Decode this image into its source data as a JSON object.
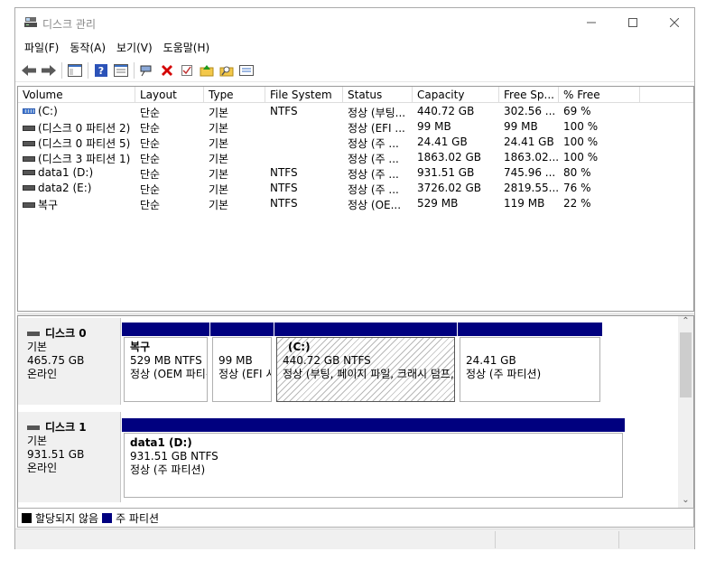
{
  "window": {
    "title": "디스크 관리"
  },
  "menu": [
    "파일(F)",
    "동작(A)",
    "보기(V)",
    "도움말(H)"
  ],
  "toolbar": [
    {
      "icon": "back-arrow-icon"
    },
    {
      "icon": "forward-arrow-icon"
    },
    {
      "icon": "console-tree-icon"
    },
    {
      "icon": "help-icon"
    },
    {
      "icon": "properties-icon"
    },
    {
      "icon": "connect-icon"
    },
    {
      "icon": "delete-icon"
    },
    {
      "icon": "check-icon"
    },
    {
      "icon": "folder-up-icon"
    },
    {
      "icon": "search-folder-icon"
    },
    {
      "icon": "list-view-icon"
    }
  ],
  "list": {
    "columns": [
      "Volume",
      "Layout",
      "Type",
      "File System",
      "Status",
      "Capacity",
      "Free Sp...",
      "% Free"
    ],
    "rows": [
      {
        "volume": "(C:)",
        "layout": "단순",
        "type": "기본",
        "fs": "NTFS",
        "status": "정상 (부팅...",
        "capacity": "440.72 GB",
        "free": "302.56 ...",
        "pct": "69 %",
        "icon": "system-volume-icon"
      },
      {
        "volume": "(디스크 0 파티션 2)",
        "layout": "단순",
        "type": "기본",
        "fs": "",
        "status": "정상 (EFI ...",
        "capacity": "99 MB",
        "free": "99 MB",
        "pct": "100 %",
        "icon": "volume-icon"
      },
      {
        "volume": "(디스크 0 파티션 5)",
        "layout": "단순",
        "type": "기본",
        "fs": "",
        "status": "정상 (주 ...",
        "capacity": "24.41 GB",
        "free": "24.41 GB",
        "pct": "100 %",
        "icon": "volume-icon"
      },
      {
        "volume": "(디스크 3 파티션 1)",
        "layout": "단순",
        "type": "기본",
        "fs": "",
        "status": "정상 (주 ...",
        "capacity": "1863.02 GB",
        "free": "1863.02...",
        "pct": "100 %",
        "icon": "volume-icon"
      },
      {
        "volume": "data1 (D:)",
        "layout": "단순",
        "type": "기본",
        "fs": "NTFS",
        "status": "정상 (주 ...",
        "capacity": "931.51 GB",
        "free": "745.96 ...",
        "pct": "80 %",
        "icon": "volume-icon"
      },
      {
        "volume": "data2 (E:)",
        "layout": "단순",
        "type": "기본",
        "fs": "NTFS",
        "status": "정상 (주 ...",
        "capacity": "3726.02 GB",
        "free": "2819.55...",
        "pct": "76 %",
        "icon": "volume-icon"
      },
      {
        "volume": "복구",
        "layout": "단순",
        "type": "기본",
        "fs": "NTFS",
        "status": "정상 (OE...",
        "capacity": "529 MB",
        "free": "119 MB",
        "pct": "22 %",
        "icon": "volume-icon"
      }
    ]
  },
  "disks": [
    {
      "name": "디스크 0",
      "type": "기본",
      "size": "465.75 GB",
      "state": "온라인",
      "partitions": [
        {
          "name": "복구",
          "size": "529 MB NTFS",
          "status": "정상 (OEM 파티션)",
          "hatched": false
        },
        {
          "name": "",
          "size": "99 MB",
          "status": "정상 (EFI 시스템 파티션)",
          "hatched": false
        },
        {
          "name": "(C:)",
          "size": "440.72 GB NTFS",
          "status": "정상 (부팅, 페이지 파일, 크래시 덤프, 주 파티션)",
          "hatched": true
        },
        {
          "name": "",
          "size": "24.41 GB",
          "status": "정상 (주 파티션)",
          "hatched": false
        }
      ]
    },
    {
      "name": "디스크 1",
      "type": "기본",
      "size": "931.51 GB",
      "state": "온라인",
      "partitions": [
        {
          "name": "data1  (D:)",
          "size": "931.51 GB NTFS",
          "status": "정상 (주 파티션)",
          "hatched": false
        }
      ]
    }
  ],
  "legend": [
    {
      "label": "할당되지 않음",
      "color": "#000000"
    },
    {
      "label": "주 파티션",
      "color": "#00007f"
    }
  ]
}
